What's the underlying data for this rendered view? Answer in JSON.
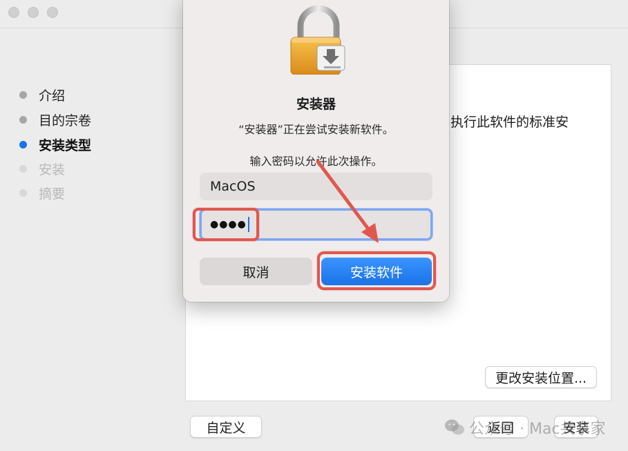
{
  "sidebar": {
    "steps": [
      {
        "label": "介绍",
        "state": "done"
      },
      {
        "label": "目的宗卷",
        "state": "done"
      },
      {
        "label": "安装类型",
        "state": "active"
      },
      {
        "label": "安装",
        "state": "pending"
      },
      {
        "label": "摘要",
        "state": "pending"
      }
    ]
  },
  "content": {
    "text": "执行此软件的标准安",
    "change_location_button": "更改安装位置..."
  },
  "footer": {
    "customize_button": "自定义",
    "back_button": "返回",
    "install_button": "安装"
  },
  "watermark": {
    "text": "公众号 · Mac共享家"
  },
  "dialog": {
    "icon": "lock-icon",
    "title": "安装器",
    "message": "“安装器”正在尝试安装新软件。",
    "prompt": "输入密码以允许此次操作。",
    "username_value": "MacOS",
    "password_value": "●●●●",
    "cancel_button": "取消",
    "confirm_button": "安装软件"
  },
  "colors": {
    "accent": "#1a73e8",
    "annotation": "#e0574f"
  }
}
